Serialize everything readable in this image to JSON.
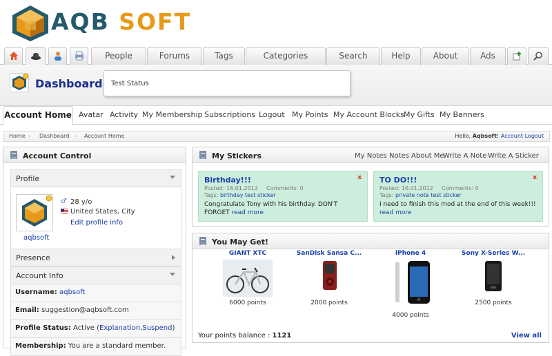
{
  "brand": {
    "logo_text_a": "AQB",
    "logo_text_b": " SOFT",
    "accent": "#e79a1a",
    "primary": "#25596b"
  },
  "nav": {
    "icon_tabs": [
      {
        "icon": "home-icon"
      },
      {
        "icon": "user-hat-icon"
      },
      {
        "icon": "person-icon"
      },
      {
        "icon": "printer-icon"
      }
    ],
    "tabs": [
      "People",
      "Forums",
      "Tags",
      "Categories",
      "Search",
      "Help",
      "About",
      "Ads"
    ],
    "right_icons": [
      {
        "icon": "add-page-icon"
      },
      {
        "icon": "search-icon"
      }
    ]
  },
  "title": {
    "text": "Dashboard",
    "status": "Test Status"
  },
  "subnav": {
    "active": "Account Home",
    "items": [
      "Avatar",
      "Activity",
      "My Membership",
      "Subscriptions",
      "Logout",
      "My Points",
      "My Account Blocks",
      "My Gifts",
      "My Banners"
    ]
  },
  "breadcrumb": {
    "items": [
      "Home",
      "Dashboard",
      "Account Home"
    ],
    "hello": "Hello,",
    "user": "Aqbsoft",
    "sep": "!",
    "logout": "Account Logout"
  },
  "account_control": {
    "title": "Account Control",
    "profile_label": "Profile",
    "age": "28 y/o",
    "location": "United States, City",
    "edit": "Edit profile info",
    "username_link": "aqbsoft",
    "presence_label": "Presence",
    "account_info_label": "Account Info",
    "username_key": "Username:",
    "username_val": "aqbsoft",
    "email_key": "Email:",
    "email_val": "suggestion@aqbsoft.com",
    "status_key": "Profile Status:",
    "status_val": "Active",
    "status_open": "(",
    "status_link1": "Explanation",
    "status_comma": ",",
    "status_link2": "Suspend",
    "status_close": ")",
    "membership_key": "Membership:",
    "membership_val": "You are a standard member."
  },
  "stickers": {
    "title": "My Stickers",
    "links": [
      "My Notes",
      "Notes About Me",
      "Write A Note",
      "Write A Sticker"
    ],
    "items": [
      {
        "title": "Birthday!!!",
        "posted": "Posted: 16.01.2012",
        "comments": "Comments: 0",
        "tags_label": "Tags:",
        "tags": [
          "birthday",
          "test",
          "sticker"
        ],
        "text": "Congratulate Tony with his birthday. DON'T FORGET",
        "more": "read more",
        "close": "x"
      },
      {
        "title": "TO DO!!!",
        "posted": "Posted: 16.01.2012",
        "comments": "Comments: 0",
        "tags_label": "Tags:",
        "tags": [
          "private note",
          "test",
          "sticker"
        ],
        "text": "I need to finish this mod at the end of this week!!!",
        "more": "read more",
        "close": "x"
      }
    ]
  },
  "may_get": {
    "title": "You May Get!",
    "items": [
      {
        "name": "GIANT XTC",
        "points": "6000 points"
      },
      {
        "name": "SanDisk Sansa C...",
        "points": "2000 points"
      },
      {
        "name": "iPhone 4",
        "points": "4000 points"
      },
      {
        "name": "Sony X-Series W...",
        "points": "2500 points"
      }
    ],
    "balance_label": "Your points balance :",
    "balance": "1121",
    "view_all": "View all"
  }
}
